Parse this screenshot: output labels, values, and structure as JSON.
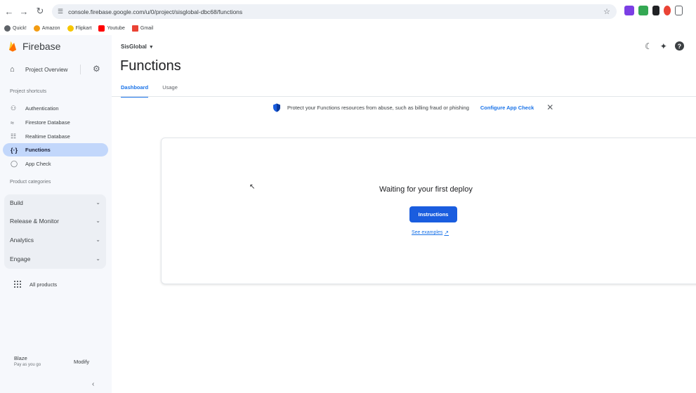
{
  "browser": {
    "url": "console.firebase.google.com/u/0/project/sisglobal-dbc68/functions",
    "bookmarks": [
      {
        "label": "Quick!",
        "color": "#5f6368"
      },
      {
        "label": "Amazon",
        "color": "#f39c12"
      },
      {
        "label": "Flipkart",
        "color": "#f7c600"
      },
      {
        "label": "Youtube",
        "color": "#ff0000"
      },
      {
        "label": "Gmail",
        "color": "#ea4335"
      }
    ]
  },
  "sidebar": {
    "logo": "Firebase",
    "project_overview": "Project Overview",
    "shortcuts_title": "Project shortcuts",
    "shortcuts": [
      {
        "label": "Authentication",
        "icon": "people-icon"
      },
      {
        "label": "Firestore Database",
        "icon": "firestore-icon"
      },
      {
        "label": "Realtime Database",
        "icon": "database-icon"
      },
      {
        "label": "Functions",
        "icon": "functions-icon",
        "active": true
      },
      {
        "label": "App Check",
        "icon": "shield-check-icon"
      }
    ],
    "categories_title": "Product categories",
    "categories": [
      "Build",
      "Release & Monitor",
      "Analytics",
      "Engage"
    ],
    "all_products": "All products",
    "plan": {
      "name": "Blaze",
      "sub": "Pay as you go",
      "action": "Modify"
    }
  },
  "header": {
    "project": "SisGlobal",
    "title": "Functions",
    "tabs": [
      "Dashboard",
      "Usage"
    ]
  },
  "banner": {
    "text": "Protect your Functions resources from abuse, such as billing fraud or phishing",
    "link": "Configure App Check"
  },
  "empty_state": {
    "title": "Waiting for your first deploy",
    "button": "Instructions",
    "link": "See examples"
  },
  "colors": {
    "accent": "#1a73e8",
    "button": "#1a5ddf",
    "active_nav": "#c2d7fb"
  }
}
